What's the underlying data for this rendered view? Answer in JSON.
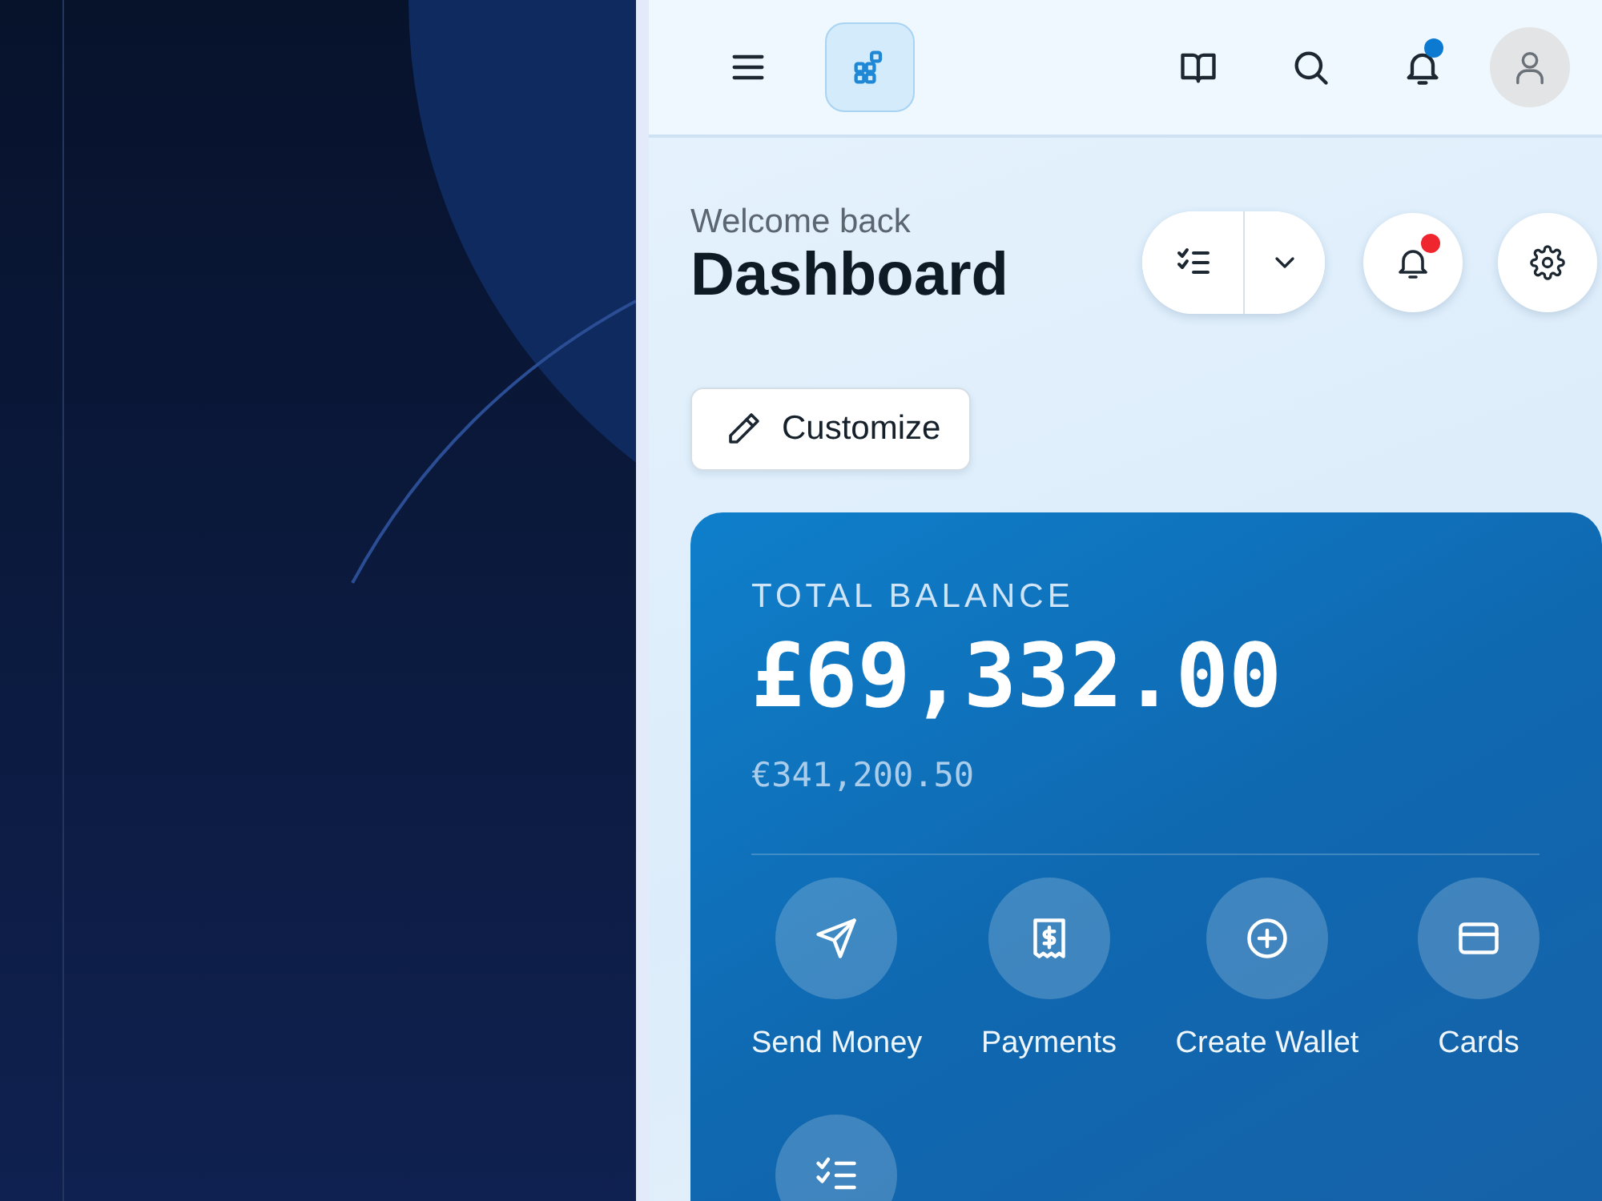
{
  "topbar": {
    "buttons": [
      {
        "kind": "menu",
        "selected": false
      },
      {
        "kind": "apps",
        "selected": true
      },
      {
        "kind": "book",
        "selected": false
      },
      {
        "kind": "search",
        "selected": false
      },
      {
        "kind": "bell",
        "selected": false,
        "badge": true
      },
      {
        "kind": "avatar",
        "selected": false
      }
    ]
  },
  "header": {
    "greeting": "Welcome back",
    "title": "Dashboard",
    "notifications_badge": true,
    "customize": "Customize"
  },
  "balance_card": {
    "label": "TOTAL BALANCE",
    "amount": "£69,332.00",
    "secondary_amount": "€341,200.50",
    "actions": [
      {
        "kind": "send",
        "label": "Send Money"
      },
      {
        "kind": "payments",
        "label": "Payments"
      },
      {
        "kind": "wallet",
        "label": "Create Wallet"
      },
      {
        "kind": "cards",
        "label": "Cards"
      },
      {
        "kind": "tasks"
      }
    ]
  }
}
